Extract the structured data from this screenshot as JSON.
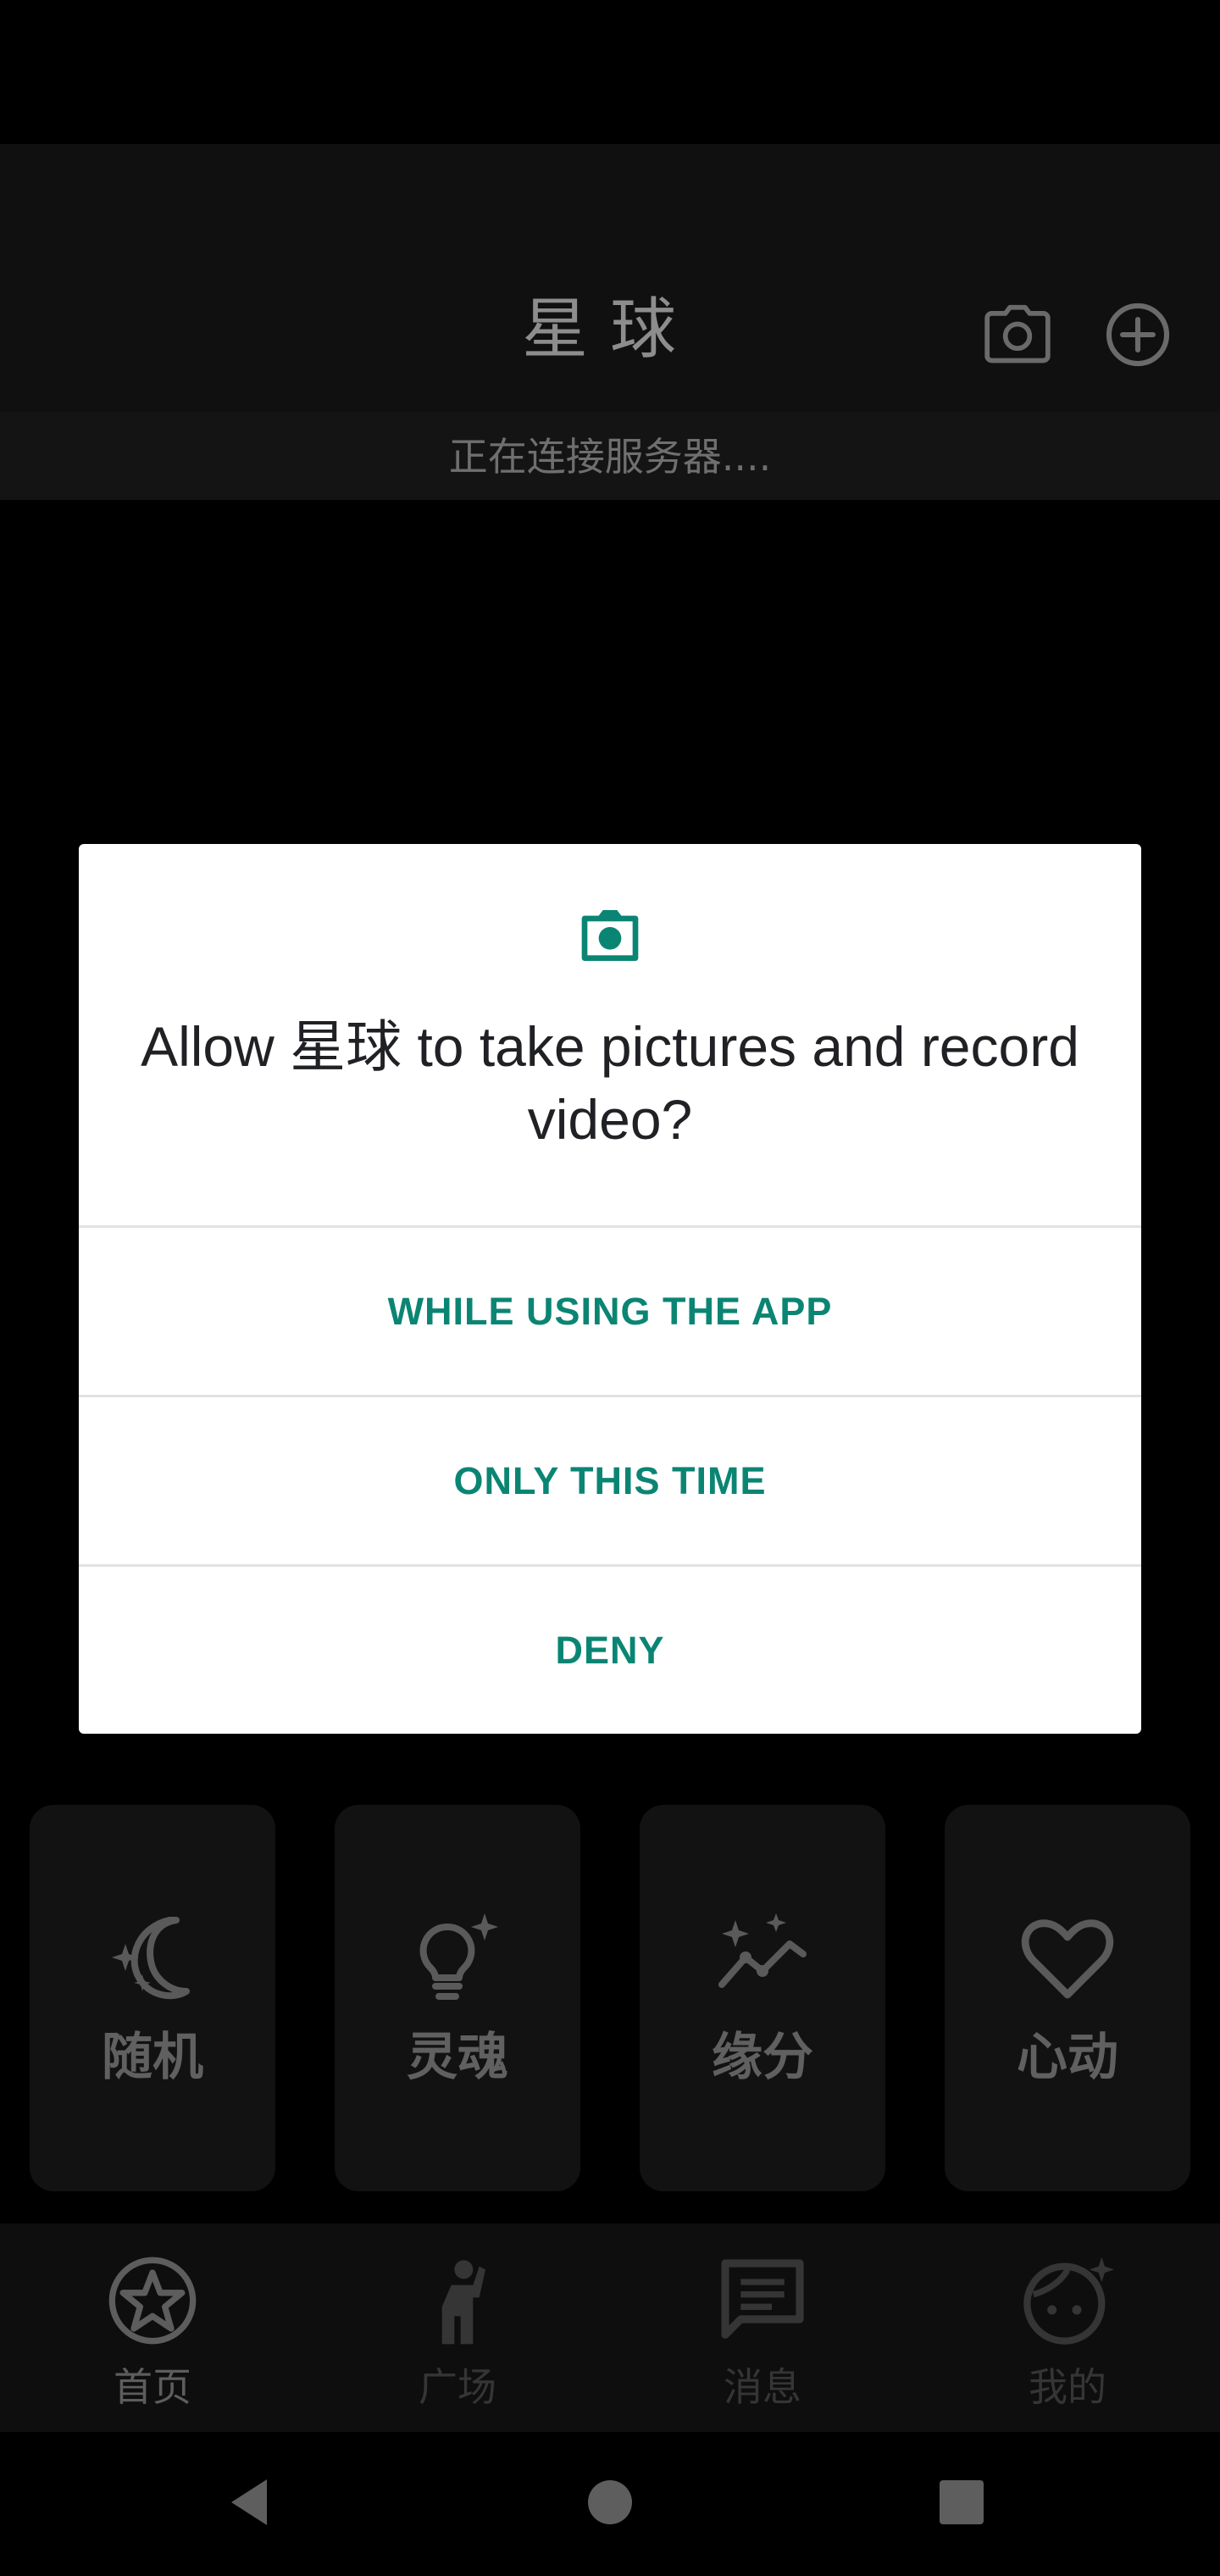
{
  "app": {
    "title": "星球",
    "connection_status": "正在连接服务器....",
    "header_icons": [
      "camera-icon",
      "add-circle-icon"
    ],
    "features": [
      {
        "label": "随机",
        "icon": "moon-sparkle-icon"
      },
      {
        "label": "灵魂",
        "icon": "lightbulb-sparkle-icon"
      },
      {
        "label": "缘分",
        "icon": "trend-sparkle-icon"
      },
      {
        "label": "心动",
        "icon": "heart-icon"
      }
    ],
    "bottom_nav": [
      {
        "label": "首页",
        "icon": "star-circle-icon",
        "active": true
      },
      {
        "label": "广场",
        "icon": "person-wave-icon",
        "active": false
      },
      {
        "label": "消息",
        "icon": "message-icon",
        "active": false
      },
      {
        "label": "我的",
        "icon": "face-icon",
        "active": false
      }
    ]
  },
  "permission_dialog": {
    "icon": "camera-icon",
    "title": "Allow 星球 to take pictures and record video?",
    "buttons": [
      "WHILE USING THE APP",
      "ONLY THIS TIME",
      "DENY"
    ],
    "accent_color": "#0b8573"
  },
  "system_nav": [
    "back-icon",
    "home-icon",
    "recents-icon"
  ]
}
